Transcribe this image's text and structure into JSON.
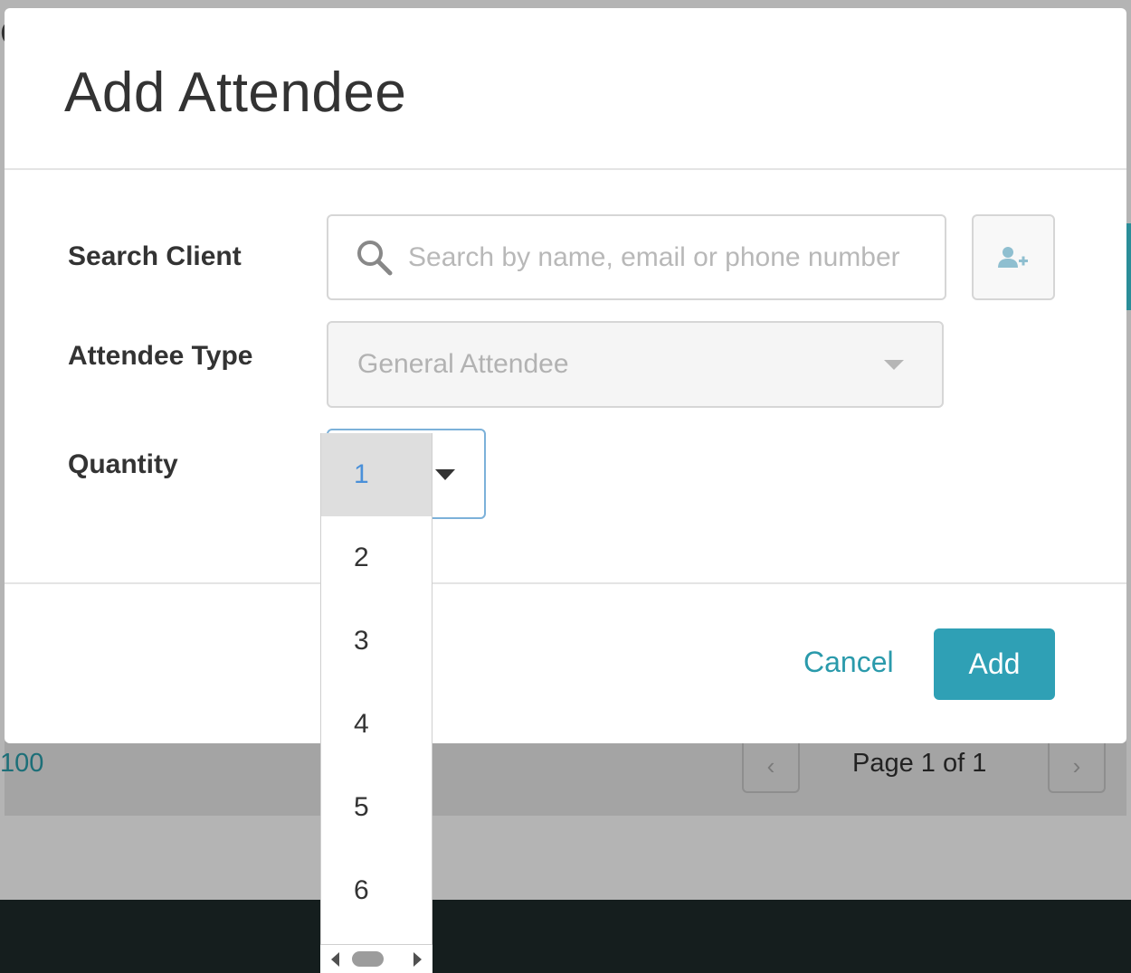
{
  "modal": {
    "title": "Add Attendee",
    "search_label": "Search Client",
    "search_placeholder": "Search by name, email or phone number",
    "type_label": "Attendee Type",
    "type_value": "General Attendee",
    "quantity_label": "Quantity",
    "quantity_value": "1",
    "quantity_options": [
      "1",
      "2",
      "3",
      "4",
      "5",
      "6"
    ],
    "cancel_label": "Cancel",
    "add_label": "Add"
  },
  "background": {
    "page_size": "100",
    "page_info": "Page 1 of 1"
  },
  "colors": {
    "accent": "#2fa0b5",
    "link": "#2a9aab",
    "focus_border": "#7cb1d9",
    "selected_option_text": "#4a90d9"
  }
}
